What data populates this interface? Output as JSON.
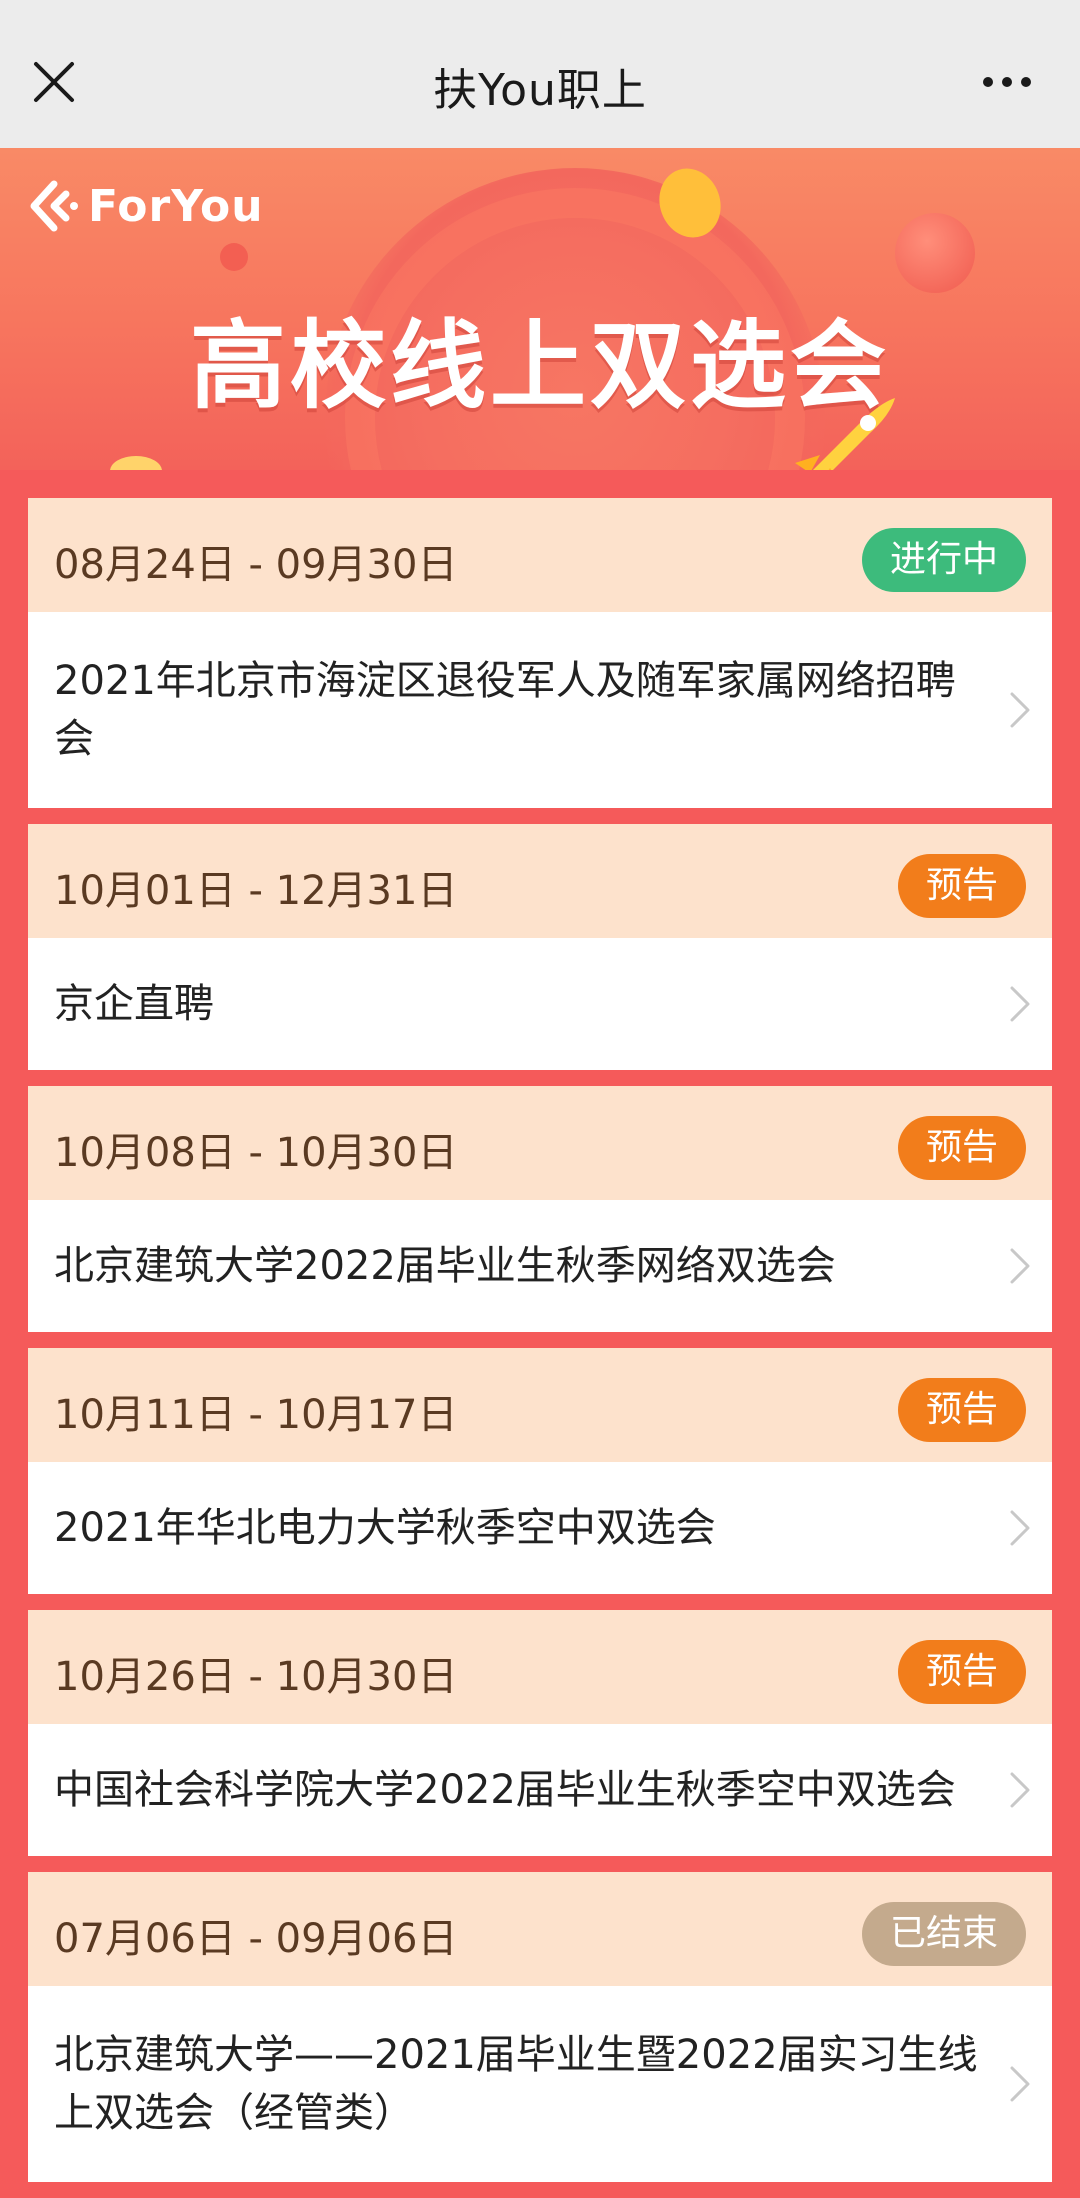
{
  "nav": {
    "title": "扶You职上"
  },
  "banner": {
    "logo_text": "ForYou",
    "headline": "高校线上双选会"
  },
  "colors": {
    "ongoing": "#3dbb7c",
    "preview": "#f27d1b",
    "ended": "#c4aa8d"
  },
  "events": [
    {
      "date": "08月24日 - 09月30日",
      "status": "进行中",
      "name": "2021年北京市海淀区退役军人及随军家属网络招聘会"
    },
    {
      "date": "10月01日 - 12月31日",
      "status": "预告",
      "name": "京企直聘"
    },
    {
      "date": "10月08日 - 10月30日",
      "status": "预告",
      "name": "北京建筑大学2022届毕业生秋季网络双选会"
    },
    {
      "date": "10月11日 - 10月17日",
      "status": "预告",
      "name": "2021年华北电力大学秋季空中双选会"
    },
    {
      "date": "10月26日 - 10月30日",
      "status": "预告",
      "name": "中国社会科学院大学2022届毕业生秋季空中双选会"
    },
    {
      "date": "07月06日 - 09月06日",
      "status": "已结束",
      "name": "北京建筑大学——2021届毕业生暨2022届实习生线上双选会（经管类）"
    }
  ]
}
